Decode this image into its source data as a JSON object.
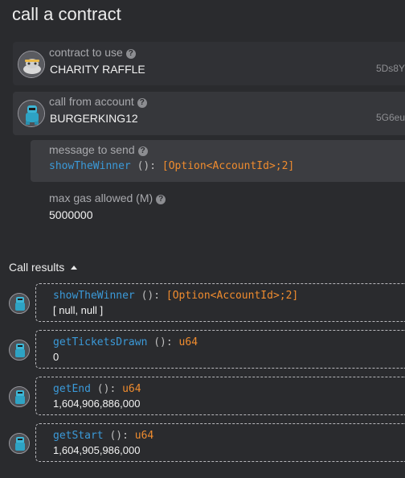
{
  "title": "call a contract",
  "contract": {
    "label": "contract to use",
    "value": "CHARITY RAFFLE",
    "address": "5Ds8Y"
  },
  "account": {
    "label": "call from account",
    "value": "BURGERKING12",
    "address": "5G6eu"
  },
  "message": {
    "label": "message to send",
    "fn": "showTheWinner",
    "paren": " ():",
    "type": "[Option<AccountId>;2]"
  },
  "gas": {
    "label": "max gas allowed (M)",
    "value": "5000000"
  },
  "results": {
    "heading": "Call results",
    "items": [
      {
        "fn": "showTheWinner",
        "paren": " ():",
        "type": "[Option<AccountId>;2]",
        "output": "[ null, null ]"
      },
      {
        "fn": "getTicketsDrawn",
        "paren": " ():",
        "type": "u64",
        "output": "0"
      },
      {
        "fn": "getEnd",
        "paren": " ():",
        "type": "u64",
        "output": "1,604,906,886,000"
      },
      {
        "fn": "getStart",
        "paren": " ():",
        "type": "u64",
        "output": "1,604,905,986,000"
      }
    ]
  },
  "colors": {
    "background": "#2a2b2e",
    "function_name": "#3b9ad9",
    "type": "#f08c2e"
  },
  "icons": [
    "help-icon",
    "contract-avatar-icon",
    "account-avatar-icon",
    "chevron-up-icon"
  ]
}
